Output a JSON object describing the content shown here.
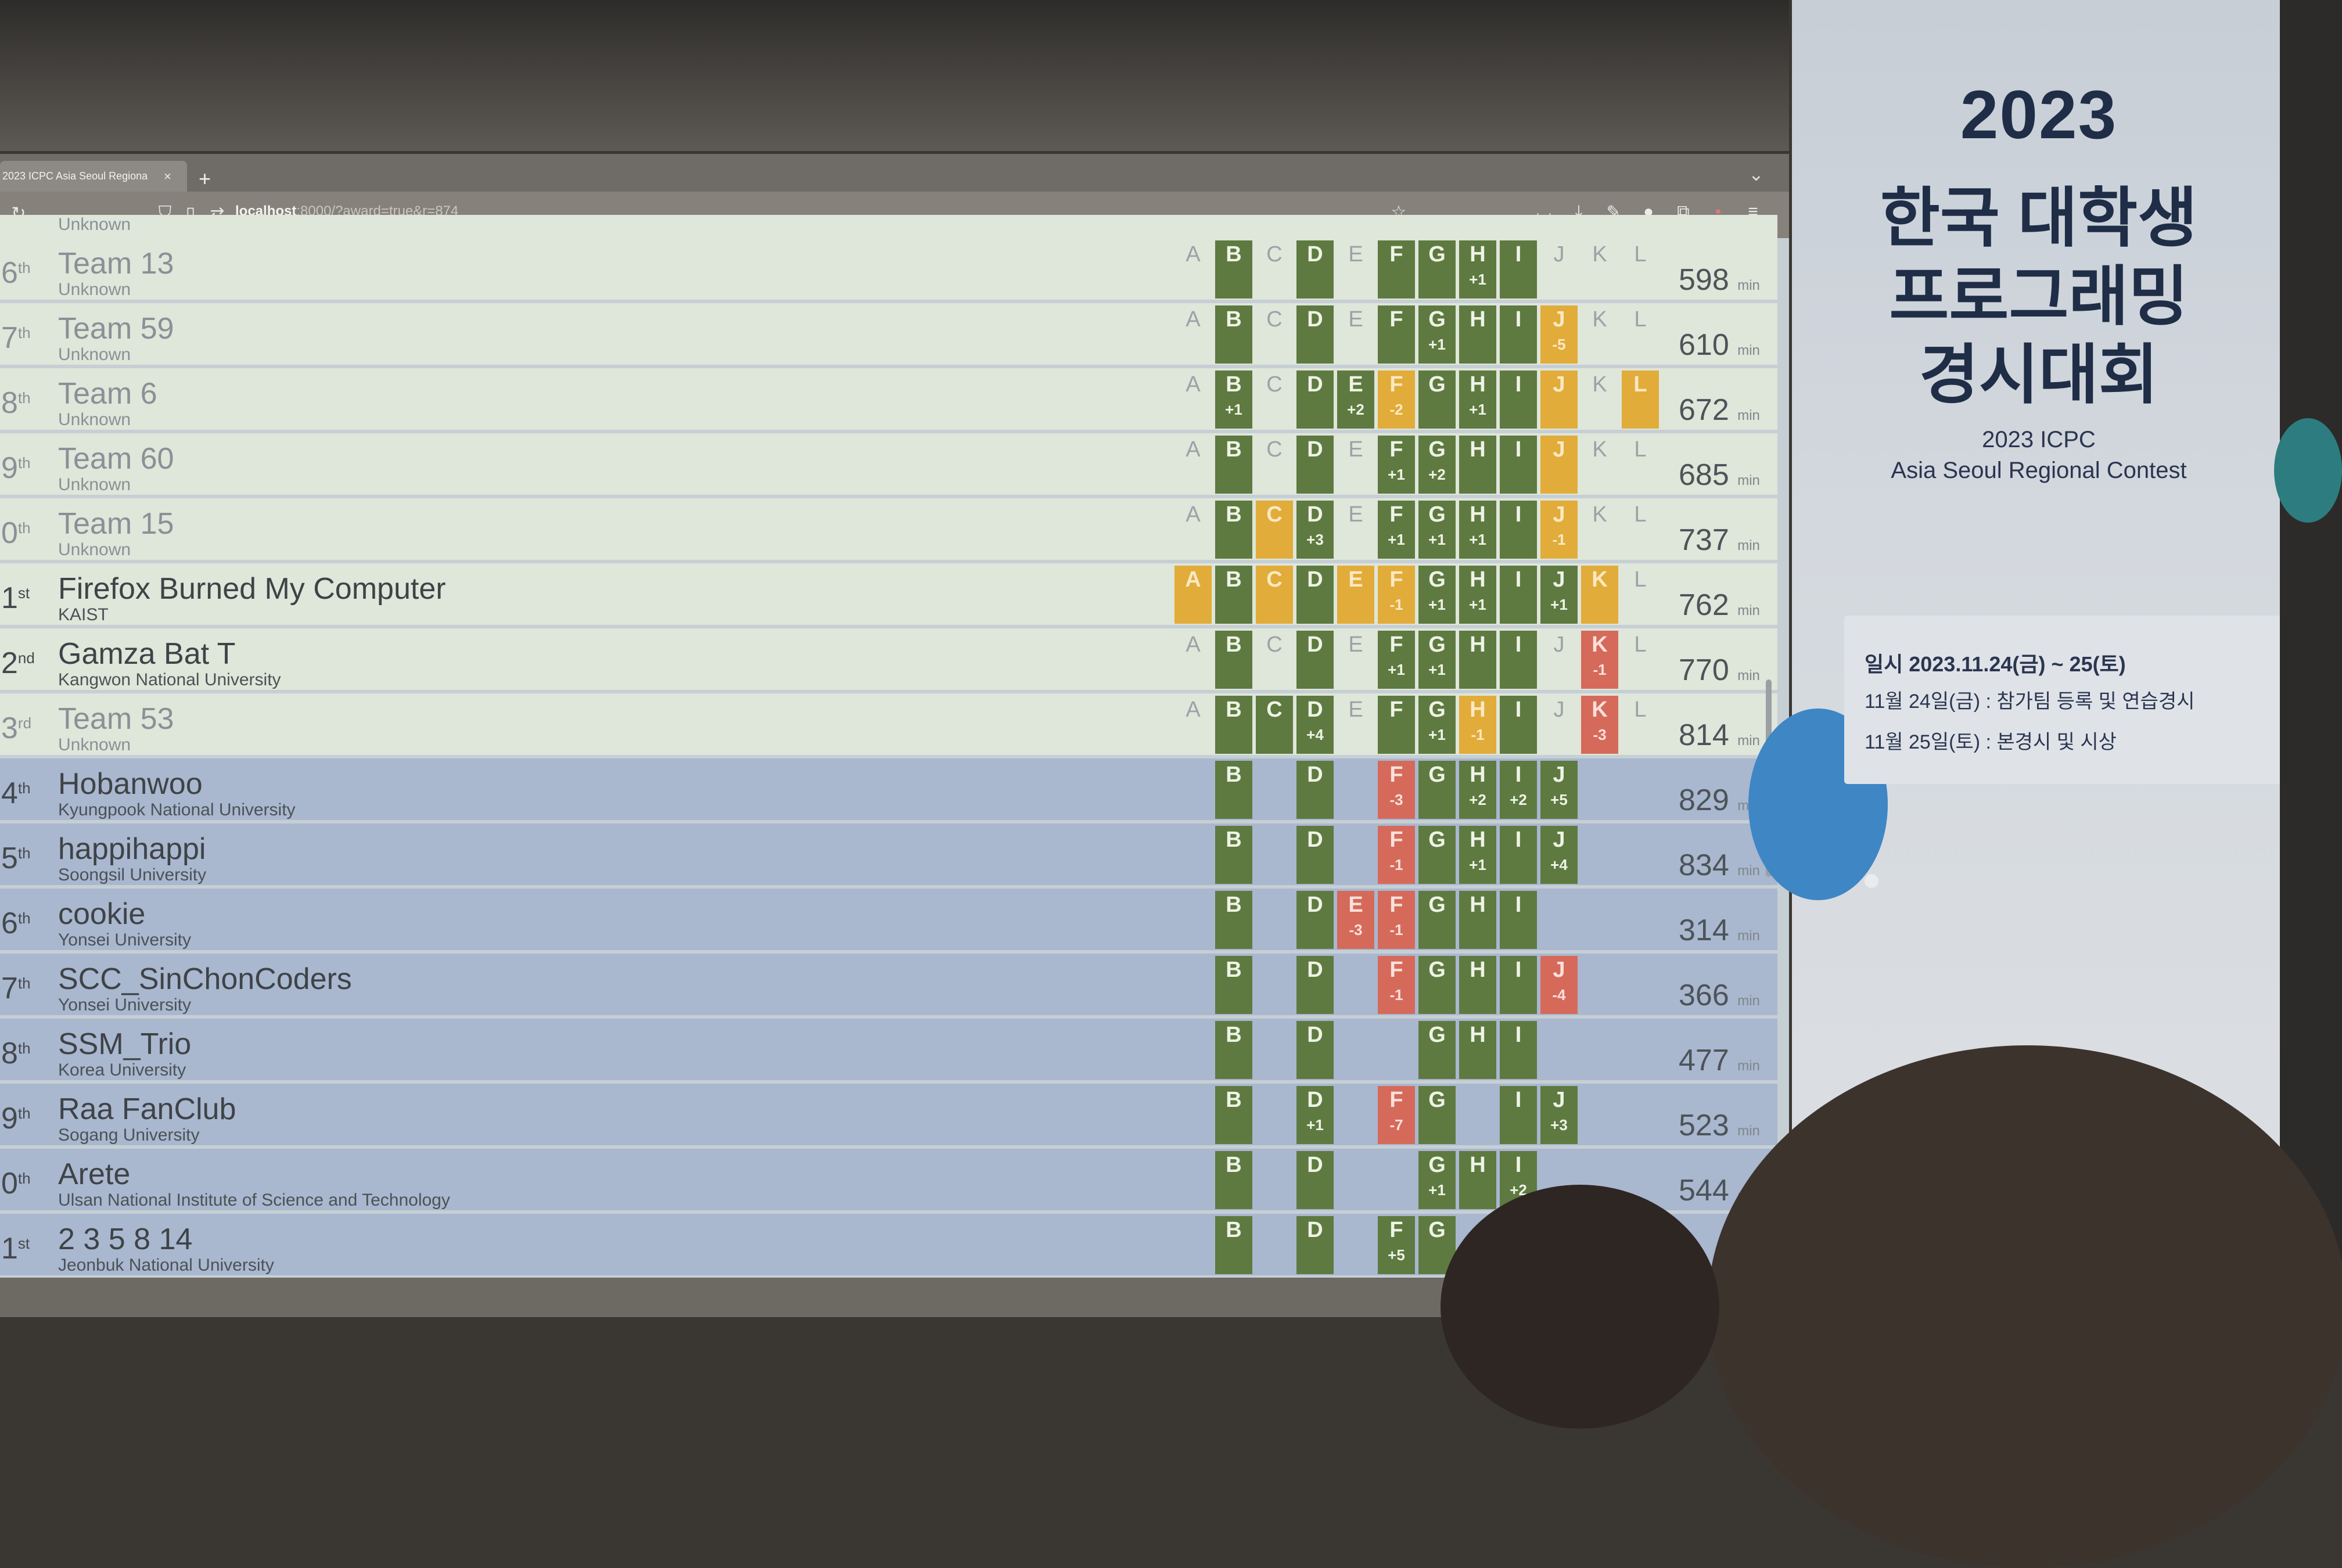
{
  "browser": {
    "tab_title": "2023 ICPC Asia Seoul Regiona",
    "tab_close": "×",
    "new_tab": "+",
    "url_host": "localhost",
    "url_rest": ":8000/?award=true&r=874"
  },
  "problems": [
    "A",
    "B",
    "C",
    "D",
    "E",
    "F",
    "G",
    "H",
    "I",
    "J",
    "K",
    "L"
  ],
  "top_partial": "Unknown",
  "rows": [
    {
      "rank": "6",
      "suffix": "th",
      "team": "Team 13",
      "uni": "Unknown",
      "penalty": "598",
      "unit": "min",
      "style": "gold faded",
      "cells": [
        [
          "none",
          ""
        ],
        [
          "solved",
          ""
        ],
        [
          "none",
          ""
        ],
        [
          "solved",
          ""
        ],
        [
          "none",
          ""
        ],
        [
          "solved",
          ""
        ],
        [
          "solved",
          ""
        ],
        [
          "solved",
          "+1"
        ],
        [
          "solved",
          ""
        ],
        [
          "none",
          ""
        ],
        [
          "none",
          ""
        ],
        [
          "none",
          ""
        ]
      ]
    },
    {
      "rank": "7",
      "suffix": "th",
      "team": "Team 59",
      "uni": "Unknown",
      "penalty": "610",
      "unit": "min",
      "style": "gold faded",
      "cells": [
        [
          "none",
          ""
        ],
        [
          "solved",
          ""
        ],
        [
          "none",
          ""
        ],
        [
          "solved",
          ""
        ],
        [
          "none",
          ""
        ],
        [
          "solved",
          ""
        ],
        [
          "solved",
          "+1"
        ],
        [
          "solved",
          ""
        ],
        [
          "solved",
          ""
        ],
        [
          "pending",
          "-5"
        ],
        [
          "none",
          ""
        ],
        [
          "none",
          ""
        ]
      ]
    },
    {
      "rank": "8",
      "suffix": "th",
      "team": "Team 6",
      "uni": "Unknown",
      "penalty": "672",
      "unit": "min",
      "style": "gold faded",
      "cells": [
        [
          "none",
          ""
        ],
        [
          "solved",
          "+1"
        ],
        [
          "none",
          ""
        ],
        [
          "solved",
          ""
        ],
        [
          "solved",
          "+2"
        ],
        [
          "pending",
          "-2"
        ],
        [
          "solved",
          ""
        ],
        [
          "solved",
          "+1"
        ],
        [
          "solved",
          ""
        ],
        [
          "pending",
          ""
        ],
        [
          "none",
          ""
        ],
        [
          "pending",
          ""
        ]
      ]
    },
    {
      "rank": "9",
      "suffix": "th",
      "team": "Team 60",
      "uni": "Unknown",
      "penalty": "685",
      "unit": "min",
      "style": "gold faded",
      "cells": [
        [
          "none",
          ""
        ],
        [
          "solved",
          ""
        ],
        [
          "none",
          ""
        ],
        [
          "solved",
          ""
        ],
        [
          "none",
          ""
        ],
        [
          "solved",
          "+1"
        ],
        [
          "solved",
          "+2"
        ],
        [
          "solved",
          ""
        ],
        [
          "solved",
          ""
        ],
        [
          "pending",
          ""
        ],
        [
          "none",
          ""
        ],
        [
          "none",
          ""
        ]
      ]
    },
    {
      "rank": "0",
      "suffix": "th",
      "team": "Team 15",
      "uni": "Unknown",
      "penalty": "737",
      "unit": "min",
      "style": "gold faded",
      "cells": [
        [
          "none",
          ""
        ],
        [
          "solved",
          ""
        ],
        [
          "pending",
          ""
        ],
        [
          "solved",
          "+3"
        ],
        [
          "none",
          ""
        ],
        [
          "solved",
          "+1"
        ],
        [
          "solved",
          "+1"
        ],
        [
          "solved",
          "+1"
        ],
        [
          "solved",
          ""
        ],
        [
          "pending",
          "-1"
        ],
        [
          "none",
          ""
        ],
        [
          "none",
          ""
        ]
      ]
    },
    {
      "rank": "1",
      "suffix": "st",
      "team": "Firefox Burned My Computer",
      "uni": "KAIST",
      "penalty": "762",
      "unit": "min",
      "style": "gold",
      "cells": [
        [
          "pending",
          ""
        ],
        [
          "solved",
          ""
        ],
        [
          "pending",
          ""
        ],
        [
          "solved",
          ""
        ],
        [
          "pending",
          ""
        ],
        [
          "pending",
          "-1"
        ],
        [
          "solved",
          "+1"
        ],
        [
          "solved",
          "+1"
        ],
        [
          "solved",
          ""
        ],
        [
          "solved",
          "+1"
        ],
        [
          "pending",
          ""
        ],
        [
          "none",
          ""
        ]
      ]
    },
    {
      "rank": "2",
      "suffix": "nd",
      "team": "Gamza Bat T",
      "uni": "Kangwon National University",
      "penalty": "770",
      "unit": "min",
      "style": "gold",
      "cells": [
        [
          "none",
          ""
        ],
        [
          "solved",
          ""
        ],
        [
          "none",
          ""
        ],
        [
          "solved",
          ""
        ],
        [
          "none",
          ""
        ],
        [
          "solved",
          "+1"
        ],
        [
          "solved",
          "+1"
        ],
        [
          "solved",
          ""
        ],
        [
          "solved",
          ""
        ],
        [
          "none",
          ""
        ],
        [
          "failed",
          "-1"
        ],
        [
          "none",
          ""
        ]
      ]
    },
    {
      "rank": "3",
      "suffix": "rd",
      "team": "Team 53",
      "uni": "Unknown",
      "penalty": "814",
      "unit": "min",
      "style": "gold faded",
      "cells": [
        [
          "none",
          ""
        ],
        [
          "solved",
          ""
        ],
        [
          "solved",
          ""
        ],
        [
          "solved",
          "+4"
        ],
        [
          "none",
          ""
        ],
        [
          "solved",
          ""
        ],
        [
          "solved",
          "+1"
        ],
        [
          "pending",
          "-1"
        ],
        [
          "solved",
          ""
        ],
        [
          "none",
          ""
        ],
        [
          "failed",
          "-3"
        ],
        [
          "none",
          ""
        ]
      ]
    },
    {
      "rank": "4",
      "suffix": "th",
      "team": "Hobanwoo",
      "uni": "Kyungpook National University",
      "penalty": "829",
      "unit": "min",
      "style": "blue",
      "cells": [
        [
          "none hidden",
          ""
        ],
        [
          "solved",
          ""
        ],
        [
          "none hidden",
          ""
        ],
        [
          "solved",
          ""
        ],
        [
          "none hidden",
          ""
        ],
        [
          "failed",
          "-3"
        ],
        [
          "solved",
          ""
        ],
        [
          "solved",
          "+2"
        ],
        [
          "solved",
          "+2"
        ],
        [
          "solved",
          "+5"
        ],
        [
          "none hidden",
          ""
        ],
        [
          "none hidden",
          ""
        ]
      ]
    },
    {
      "rank": "5",
      "suffix": "th",
      "team": "happihappi",
      "uni": "Soongsil University",
      "penalty": "834",
      "unit": "min",
      "style": "blue",
      "cells": [
        [
          "none hidden",
          ""
        ],
        [
          "solved",
          ""
        ],
        [
          "none hidden",
          ""
        ],
        [
          "solved",
          ""
        ],
        [
          "none hidden",
          ""
        ],
        [
          "failed",
          "-1"
        ],
        [
          "solved",
          ""
        ],
        [
          "solved",
          "+1"
        ],
        [
          "solved",
          ""
        ],
        [
          "solved",
          "+4"
        ],
        [
          "none hidden",
          ""
        ],
        [
          "none hidden",
          ""
        ]
      ]
    },
    {
      "rank": "6",
      "suffix": "th",
      "team": "cookie",
      "uni": "Yonsei University",
      "penalty": "314",
      "unit": "min",
      "style": "blue",
      "cells": [
        [
          "none hidden",
          ""
        ],
        [
          "solved",
          ""
        ],
        [
          "none hidden",
          ""
        ],
        [
          "solved",
          ""
        ],
        [
          "failed",
          "-3"
        ],
        [
          "failed",
          "-1"
        ],
        [
          "solved",
          ""
        ],
        [
          "solved",
          ""
        ],
        [
          "solved",
          ""
        ],
        [
          "none hidden",
          ""
        ],
        [
          "none hidden",
          ""
        ],
        [
          "none hidden",
          ""
        ]
      ]
    },
    {
      "rank": "7",
      "suffix": "th",
      "team": "SCC_SinChonCoders",
      "uni": "Yonsei University",
      "penalty": "366",
      "unit": "min",
      "style": "blue",
      "cells": [
        [
          "none hidden",
          ""
        ],
        [
          "solved",
          ""
        ],
        [
          "none hidden",
          ""
        ],
        [
          "solved",
          ""
        ],
        [
          "none hidden",
          ""
        ],
        [
          "failed",
          "-1"
        ],
        [
          "solved",
          ""
        ],
        [
          "solved",
          ""
        ],
        [
          "solved",
          ""
        ],
        [
          "failed",
          "-4"
        ],
        [
          "none hidden",
          ""
        ],
        [
          "none hidden",
          ""
        ]
      ]
    },
    {
      "rank": "8",
      "suffix": "th",
      "team": "SSM_Trio",
      "uni": "Korea University",
      "penalty": "477",
      "unit": "min",
      "style": "blue",
      "cells": [
        [
          "none hidden",
          ""
        ],
        [
          "solved",
          ""
        ],
        [
          "none hidden",
          ""
        ],
        [
          "solved",
          ""
        ],
        [
          "none hidden",
          ""
        ],
        [
          "none hidden",
          ""
        ],
        [
          "solved",
          ""
        ],
        [
          "solved",
          ""
        ],
        [
          "solved",
          ""
        ],
        [
          "none hidden",
          ""
        ],
        [
          "none hidden",
          ""
        ],
        [
          "none hidden",
          ""
        ]
      ]
    },
    {
      "rank": "9",
      "suffix": "th",
      "team": "Raa FanClub",
      "uni": "Sogang University",
      "penalty": "523",
      "unit": "min",
      "style": "blue",
      "cells": [
        [
          "none hidden",
          ""
        ],
        [
          "solved",
          ""
        ],
        [
          "none hidden",
          ""
        ],
        [
          "solved",
          "+1"
        ],
        [
          "none hidden",
          ""
        ],
        [
          "failed",
          "-7"
        ],
        [
          "solved",
          ""
        ],
        [
          "none hidden",
          ""
        ],
        [
          "solved",
          ""
        ],
        [
          "solved",
          "+3"
        ],
        [
          "none hidden",
          ""
        ],
        [
          "none hidden",
          ""
        ]
      ]
    },
    {
      "rank": "0",
      "suffix": "th",
      "team": "Arete",
      "uni": "Ulsan National Institute of Science and Technology",
      "penalty": "544",
      "unit": "min",
      "style": "blue",
      "cells": [
        [
          "none hidden",
          ""
        ],
        [
          "solved",
          ""
        ],
        [
          "none hidden",
          ""
        ],
        [
          "solved",
          ""
        ],
        [
          "none hidden",
          ""
        ],
        [
          "none hidden",
          ""
        ],
        [
          "solved",
          "+1"
        ],
        [
          "solved",
          ""
        ],
        [
          "solved",
          "+2"
        ],
        [
          "none hidden",
          ""
        ],
        [
          "none hidden",
          ""
        ],
        [
          "none hidden",
          ""
        ]
      ]
    },
    {
      "rank": "1",
      "suffix": "st",
      "team": "2 3 5 8 14",
      "uni": "Jeonbuk National University",
      "penalty": "",
      "unit": "",
      "style": "blue",
      "cells": [
        [
          "none hidden",
          ""
        ],
        [
          "solved",
          ""
        ],
        [
          "none hidden",
          ""
        ],
        [
          "solved",
          ""
        ],
        [
          "none hidden",
          ""
        ],
        [
          "solved",
          "+5"
        ],
        [
          "solved",
          ""
        ],
        [
          "none hidden",
          ""
        ],
        [
          "none hidden",
          ""
        ],
        [
          "none hidden",
          ""
        ],
        [
          "none hidden",
          ""
        ],
        [
          "none hidden",
          ""
        ]
      ]
    }
  ],
  "banner": {
    "year": "2023",
    "line1": "한국 대학생",
    "line2": "프로그래밍",
    "line3": "경시대회",
    "sub1": "2023 ICPC",
    "sub2": "Asia Seoul Regional Contest",
    "date": "일시  2023.11.24(금) ~ 25(토)",
    "day1": "11월 24일(금) : 참가팀 등록 및 연습경시",
    "day2": "11월 25일(토) : 본경시 및 시상"
  },
  "colors": {
    "solved": "#5e7a40",
    "pending": "#e2ac3a",
    "failed": "#d66a5a",
    "gold_row": "#dfe6da",
    "blue_row": "#a9b7cf"
  }
}
